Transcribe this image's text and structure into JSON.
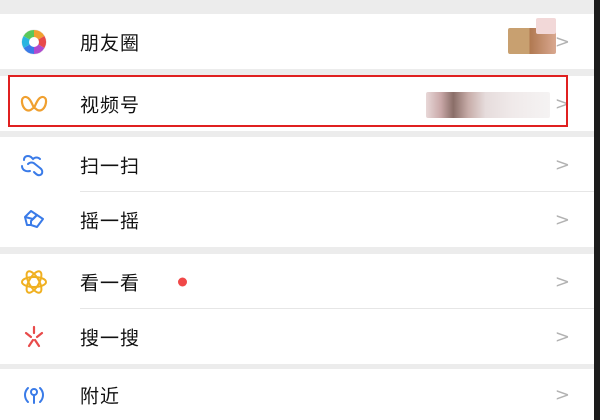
{
  "menu": {
    "moments": {
      "label": "朋友圈",
      "icon": "moments-icon"
    },
    "channels": {
      "label": "视频号",
      "icon": "channels-icon"
    },
    "scan": {
      "label": "扫一扫",
      "icon": "scan-icon"
    },
    "shake": {
      "label": "摇一摇",
      "icon": "shake-icon"
    },
    "top_stories": {
      "label": "看一看",
      "icon": "top-stories-icon"
    },
    "search": {
      "label": "搜一搜",
      "icon": "search-icon"
    },
    "nearby": {
      "label": "附近",
      "icon": "nearby-icon"
    }
  },
  "chevron": ">",
  "colors": {
    "highlight": "#e02020",
    "badge": "#f04848",
    "background": "#ececec"
  }
}
